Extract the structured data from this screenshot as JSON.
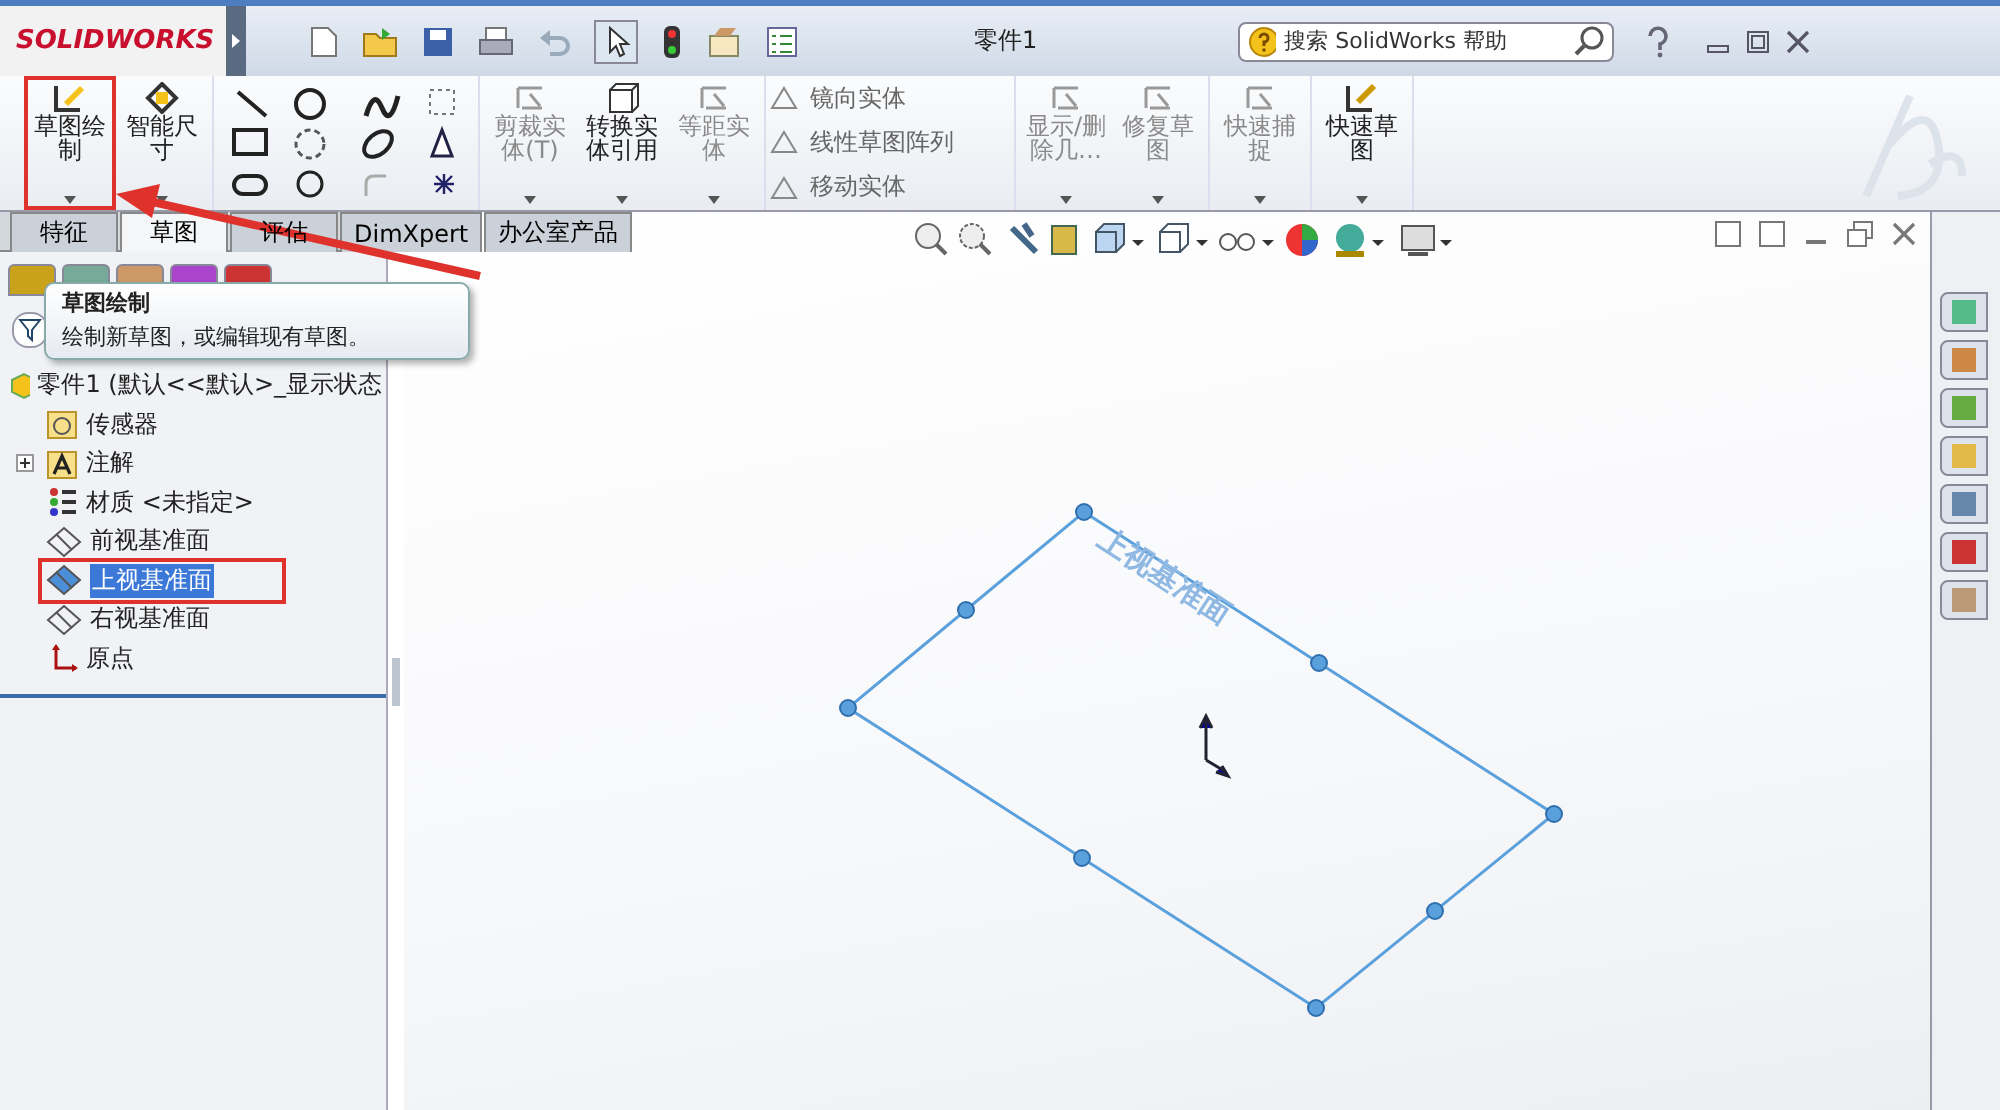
{
  "window": {
    "app_name": "SOLIDWORKS",
    "title": "零件1",
    "search": {
      "placeholder": "搜索 SolidWorks 帮助"
    }
  },
  "ribbon": {
    "groups": [
      {
        "kind": "large",
        "items": [
          {
            "label": "草图绘制",
            "disabled": false,
            "marked": true
          },
          {
            "label": "智能尺寸",
            "disabled": false,
            "marked": false
          }
        ]
      },
      {
        "kind": "tools"
      },
      {
        "kind": "large",
        "items": [
          {
            "label": "剪裁实体(T)",
            "disabled": true,
            "marked": false
          },
          {
            "label": "转换实体引用",
            "disabled": false,
            "marked": false
          },
          {
            "label": "等距实体",
            "disabled": true,
            "marked": false
          }
        ]
      },
      {
        "kind": "stacked",
        "items": [
          {
            "label": "镜向实体",
            "disabled": true
          },
          {
            "label": "线性草图阵列",
            "disabled": true
          },
          {
            "label": "移动实体",
            "disabled": true
          }
        ]
      },
      {
        "kind": "large",
        "items": [
          {
            "label": "显示/删除几…",
            "disabled": true,
            "marked": false
          },
          {
            "label": "修复草图",
            "disabled": true,
            "marked": false
          }
        ]
      },
      {
        "kind": "large",
        "items": [
          {
            "label": "快速捕捉",
            "disabled": true,
            "marked": false
          }
        ]
      },
      {
        "kind": "large",
        "items": [
          {
            "label": "快速草图",
            "disabled": false,
            "marked": false
          }
        ]
      }
    ]
  },
  "tabs": [
    {
      "label": "特征",
      "selected": false
    },
    {
      "label": "草图",
      "selected": true
    },
    {
      "label": "评估",
      "selected": false
    },
    {
      "label": "DimXpert",
      "selected": false
    },
    {
      "label": "办公室产品",
      "selected": false
    }
  ],
  "tooltip": {
    "title": "草图绘制",
    "text": "绘制新草图，或编辑现有草图。"
  },
  "tree": [
    {
      "label": "零件1 (默认<<默认>_显示状态",
      "kind": "part",
      "selected": false,
      "marked": false,
      "children": [
        {
          "label": "传感器",
          "kind": "sensor",
          "selected": false,
          "marked": false
        },
        {
          "label": "注解",
          "kind": "annotation",
          "selected": false,
          "marked": false,
          "expandable": true
        },
        {
          "label": "材质 <未指定>",
          "kind": "material",
          "selected": false,
          "marked": false
        },
        {
          "label": "前视基准面",
          "kind": "plane",
          "selected": false,
          "marked": false
        },
        {
          "label": "上视基准面",
          "kind": "plane",
          "selected": true,
          "marked": true
        },
        {
          "label": "右视基准面",
          "kind": "plane",
          "selected": false,
          "marked": false
        },
        {
          "label": "原点",
          "kind": "origin",
          "selected": false,
          "marked": false
        }
      ]
    }
  ],
  "viewport": {
    "plane_label": "上视基准面"
  }
}
